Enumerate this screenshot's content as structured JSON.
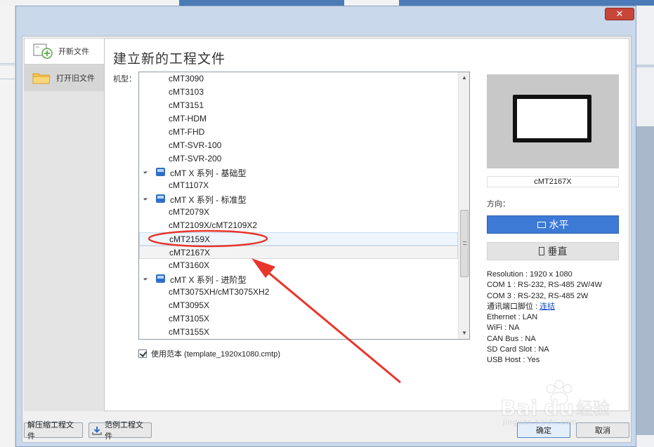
{
  "dialog": {
    "title": "建立新的工程文件",
    "close_label": "✕"
  },
  "nav": {
    "new_file": "开新文件",
    "open_old": "打开旧文件"
  },
  "model_label": "机型：",
  "tree": [
    {
      "kind": "model",
      "text": "cMT3090"
    },
    {
      "kind": "model",
      "text": "cMT3103"
    },
    {
      "kind": "model",
      "text": "cMT3151"
    },
    {
      "kind": "model",
      "text": "cMT-HDM"
    },
    {
      "kind": "model",
      "text": "cMT-FHD"
    },
    {
      "kind": "model",
      "text": "cMT-SVR-100"
    },
    {
      "kind": "model",
      "text": "cMT-SVR-200"
    },
    {
      "kind": "group",
      "text": "cMT X 系列 - 基础型"
    },
    {
      "kind": "model",
      "text": "cMT1107X"
    },
    {
      "kind": "group",
      "text": "cMT X 系列 - 标准型"
    },
    {
      "kind": "model",
      "text": "cMT2079X"
    },
    {
      "kind": "model",
      "text": "cMT2109X/cMT2109X2"
    },
    {
      "kind": "model",
      "text": "cMT2159X",
      "state": "hover"
    },
    {
      "kind": "model",
      "text": "cMT2167X",
      "state": "selected"
    },
    {
      "kind": "model",
      "text": "cMT3160X"
    },
    {
      "kind": "group",
      "text": "cMT X 系列 - 进阶型"
    },
    {
      "kind": "model",
      "text": "cMT3075XH/cMT3075XH2"
    },
    {
      "kind": "model",
      "text": "cMT3095X"
    },
    {
      "kind": "model",
      "text": "cMT3105X"
    },
    {
      "kind": "model",
      "text": "cMT3155X"
    }
  ],
  "template": {
    "checked": true,
    "label": "使用范本 (template_1920x1080.cmtp)"
  },
  "preview": {
    "model_name": "cMT2167X"
  },
  "orientation": {
    "label": "方向：",
    "horizontal": "水平",
    "vertical": "垂直"
  },
  "specs": {
    "resolution": "Resolution : 1920 x 1080",
    "com1": "COM 1 : RS-232, RS-485 2W/4W",
    "com3": "COM 3 : RS-232, RS-485 2W",
    "pinout_label": "通讯端口脚位 : ",
    "pinout_link": "连结",
    "ethernet": "Ethernet : LAN",
    "wifi": "WiFi : NA",
    "canbus": "CAN Bus : NA",
    "sdcard": "SD Card Slot : NA",
    "usbhost": "USB Host : Yes"
  },
  "footer": {
    "decompress": "解压缩工程文件",
    "examples": "范例工程文件",
    "ok": "确定",
    "cancel": "取消"
  },
  "watermark": {
    "text": "jingyan.baidu.com"
  },
  "colors": {
    "accent": "#3d7ad6",
    "annotation": "#e8352c",
    "link": "#1a4fc9"
  }
}
